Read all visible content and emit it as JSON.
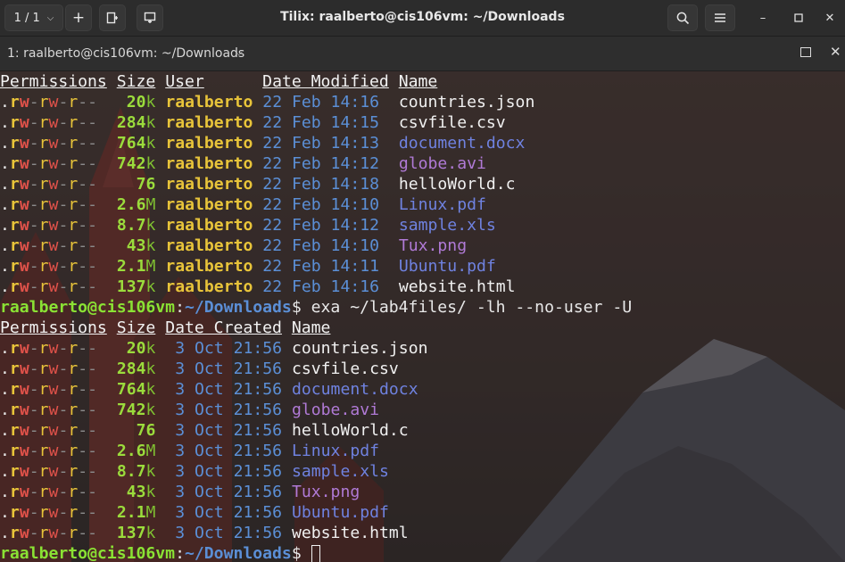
{
  "window": {
    "title": "Tilix: raalberto@cis106vm: ~/Downloads",
    "session_count": "1 / 1"
  },
  "tab": {
    "title": "1: raalberto@cis106vm: ~/Downloads"
  },
  "colors": {
    "prompt_user": "#8ae234",
    "path": "#5b8fd6",
    "size": "#9bdc3c",
    "user": "#e8c43a"
  },
  "listing1": {
    "headers": [
      "Permissions",
      "Size",
      "User",
      "Date Modified",
      "Name"
    ],
    "rows": [
      {
        "size": "20",
        "unit": "k",
        "user": "raalberto",
        "date": "22 Feb 14:16",
        "name": "countries.json",
        "kind": "plain"
      },
      {
        "size": "284",
        "unit": "k",
        "user": "raalberto",
        "date": "22 Feb 14:15",
        "name": "csvfile.csv",
        "kind": "plain"
      },
      {
        "size": "764",
        "unit": "k",
        "user": "raalberto",
        "date": "22 Feb 14:13",
        "name": "document.docx",
        "kind": "doc"
      },
      {
        "size": "742",
        "unit": "k",
        "user": "raalberto",
        "date": "22 Feb 14:12",
        "name": "globe.avi",
        "kind": "media"
      },
      {
        "size": "76",
        "unit": "",
        "user": "raalberto",
        "date": "22 Feb 14:18",
        "name": "helloWorld.c",
        "kind": "plain"
      },
      {
        "size": "2.6",
        "unit": "M",
        "user": "raalberto",
        "date": "22 Feb 14:10",
        "name": "Linux.pdf",
        "kind": "doc"
      },
      {
        "size": "8.7",
        "unit": "k",
        "user": "raalberto",
        "date": "22 Feb 14:12",
        "name": "sample.xls",
        "kind": "doc"
      },
      {
        "size": "43",
        "unit": "k",
        "user": "raalberto",
        "date": "22 Feb 14:10",
        "name": "Tux.png",
        "kind": "media"
      },
      {
        "size": "2.1",
        "unit": "M",
        "user": "raalberto",
        "date": "22 Feb 14:11",
        "name": "Ubuntu.pdf",
        "kind": "doc"
      },
      {
        "size": "137",
        "unit": "k",
        "user": "raalberto",
        "date": "22 Feb 14:16",
        "name": "website.html",
        "kind": "plain"
      }
    ]
  },
  "prompt": {
    "user": "raalberto@cis106vm",
    "colon": ":",
    "path": "~/Downloads",
    "symbol": "$",
    "command": " exa ~/lab4files/ -lh --no-user -U"
  },
  "listing2": {
    "headers": [
      "Permissions",
      "Size",
      "Date Created",
      "Name"
    ],
    "rows": [
      {
        "size": "20",
        "unit": "k",
        "date": " 3 Oct 21:56",
        "name": "countries.json",
        "kind": "plain"
      },
      {
        "size": "284",
        "unit": "k",
        "date": " 3 Oct 21:56",
        "name": "csvfile.csv",
        "kind": "plain"
      },
      {
        "size": "764",
        "unit": "k",
        "date": " 3 Oct 21:56",
        "name": "document.docx",
        "kind": "doc"
      },
      {
        "size": "742",
        "unit": "k",
        "date": " 3 Oct 21:56",
        "name": "globe.avi",
        "kind": "media"
      },
      {
        "size": "76",
        "unit": "",
        "date": " 3 Oct 21:56",
        "name": "helloWorld.c",
        "kind": "plain"
      },
      {
        "size": "2.6",
        "unit": "M",
        "date": " 3 Oct 21:56",
        "name": "Linux.pdf",
        "kind": "doc"
      },
      {
        "size": "8.7",
        "unit": "k",
        "date": " 3 Oct 21:56",
        "name": "sample.xls",
        "kind": "doc"
      },
      {
        "size": "43",
        "unit": "k",
        "date": " 3 Oct 21:56",
        "name": "Tux.png",
        "kind": "media"
      },
      {
        "size": "2.1",
        "unit": "M",
        "date": " 3 Oct 21:56",
        "name": "Ubuntu.pdf",
        "kind": "doc"
      },
      {
        "size": "137",
        "unit": "k",
        "date": " 3 Oct 21:56",
        "name": "website.html",
        "kind": "plain"
      }
    ]
  },
  "permissions": {
    "dot": ".",
    "r1": "r",
    "w1": "w",
    "sep1": "-",
    "r2": "r",
    "w2": "w",
    "sep2": "-",
    "r3": "r",
    "rest": "--"
  }
}
